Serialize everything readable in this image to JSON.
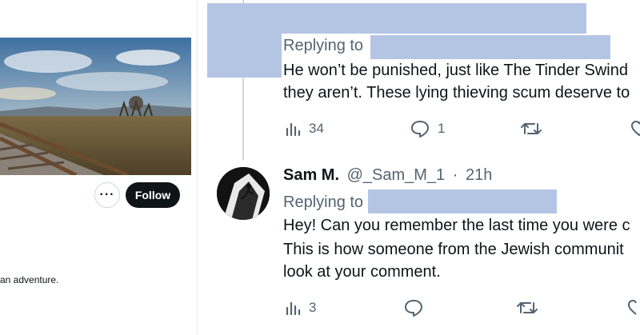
{
  "profile": {
    "more_label": "···",
    "follow_label": "Follow",
    "bio_fragment": "an adventure."
  },
  "tweet1": {
    "replying_label": "Replying to",
    "text_lines": [
      "He won’t be punished, just like The Tinder Swind",
      "they aren’t. These lying thieving scum deserve to"
    ],
    "stats": {
      "views": "34",
      "replies": "1"
    }
  },
  "tweet2": {
    "author_name": "Sam M.",
    "handle": "@_Sam_M_1",
    "separator": "·",
    "time": "21h",
    "replying_label": "Replying to",
    "text_lines": [
      "Hey! Can you remember the last time you were c",
      "This is how someone from the Jewish communit",
      "look at your comment."
    ],
    "stats": {
      "views": "3"
    }
  },
  "colors": {
    "redaction": "#b4c5e4",
    "follow_bg": "#0f1419",
    "muted_text": "#536471"
  },
  "icons": [
    "more-icon",
    "views-icon",
    "reply-icon",
    "retweet-icon",
    "like-icon"
  ]
}
